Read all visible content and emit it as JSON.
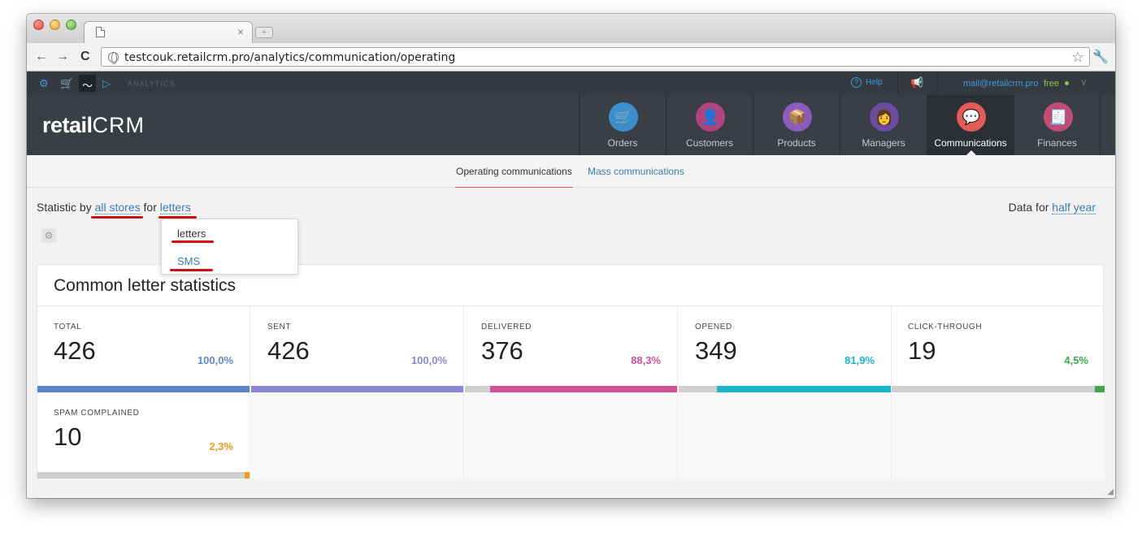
{
  "browser": {
    "url": "testcouk.retailcrm.pro/analytics/communication/operating"
  },
  "appbar": {
    "analytics_label": "ANALYTICS",
    "help": "Help",
    "email": "mail@retailcrm.pro",
    "plan": "free"
  },
  "logo": {
    "retail": "retail",
    "crm": "CRM"
  },
  "nav": [
    {
      "label": "Orders",
      "color": "#3a8fcc",
      "glyph": "🛒"
    },
    {
      "label": "Customers",
      "color": "#b0447e",
      "glyph": "👤"
    },
    {
      "label": "Products",
      "color": "#8b5bbd",
      "glyph": "📦"
    },
    {
      "label": "Managers",
      "color": "#6b4aa0",
      "glyph": "👩"
    },
    {
      "label": "Communications",
      "color": "#e25b56",
      "glyph": "💬"
    },
    {
      "label": "Finances",
      "color": "#c24a75",
      "glyph": "🧾"
    }
  ],
  "subtabs": {
    "active": "Operating communications",
    "other": "Mass communications"
  },
  "statline": {
    "prefix": "Statistic by",
    "stores": "all stores",
    "for": "for",
    "type": "letters"
  },
  "dataline": {
    "prefix": "Data for",
    "period": "half year"
  },
  "dropdown": {
    "option1": "letters",
    "option2": "SMS"
  },
  "card": {
    "title": "Common letter statistics",
    "stats": [
      {
        "label": "TOTAL",
        "value": "426",
        "pct": "100,0%",
        "color": "#5b86cf",
        "fraction": 1.0
      },
      {
        "label": "SENT",
        "value": "426",
        "pct": "100,0%",
        "color": "#8b85d6",
        "fraction": 1.0
      },
      {
        "label": "DELIVERED",
        "value": "376",
        "pct": "88,3%",
        "color": "#d1509a",
        "fraction": 0.883
      },
      {
        "label": "OPENED",
        "value": "349",
        "pct": "81,9%",
        "color": "#1ab5c9",
        "fraction": 0.819
      },
      {
        "label": "CLICK-THROUGH",
        "value": "19",
        "pct": "4,5%",
        "color": "#3fa94a",
        "fraction": 0.045
      },
      {
        "label": "SPAM COMPLAINED",
        "value": "10",
        "pct": "2,3%",
        "color": "#f29a1a",
        "fraction": 0.023
      }
    ]
  }
}
